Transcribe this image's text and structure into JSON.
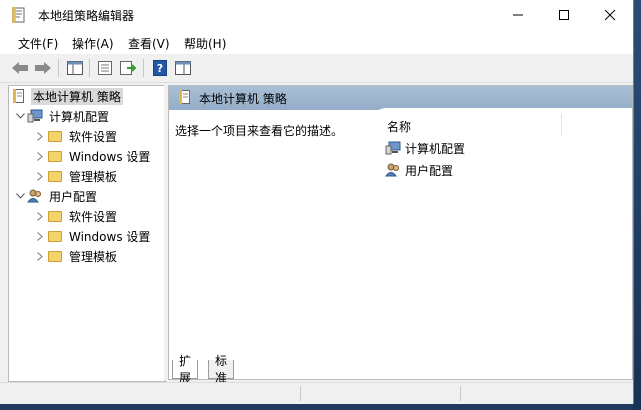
{
  "window": {
    "title": "本地组策略编辑器",
    "icon": "policy-doc-icon"
  },
  "menu": [
    "文件(F)",
    "操作(A)",
    "查看(V)",
    "帮助(H)"
  ],
  "toolbar": {
    "icons": [
      "back-arrow-icon",
      "forward-arrow-icon",
      "show-hide-tree-icon",
      "properties-icon",
      "export-list-icon",
      "help-icon",
      "show-pane-icon"
    ]
  },
  "tree": {
    "root": "本地计算机 策略",
    "computer": {
      "label": "计算机配置",
      "children": [
        "软件设置",
        "Windows 设置",
        "管理模板"
      ]
    },
    "user": {
      "label": "用户配置",
      "children": [
        "软件设置",
        "Windows 设置",
        "管理模板"
      ]
    }
  },
  "details": {
    "header": "本地计算机 策略",
    "description": "选择一个项目来查看它的描述。",
    "column_name": "名称",
    "items": [
      "计算机配置",
      "用户配置"
    ]
  },
  "tabs": [
    "扩展",
    "标准"
  ],
  "colors": {
    "header_blue": "#a9bfd6",
    "folder_yellow": "#f4d36a",
    "selection_gray": "#d9d9d9"
  }
}
